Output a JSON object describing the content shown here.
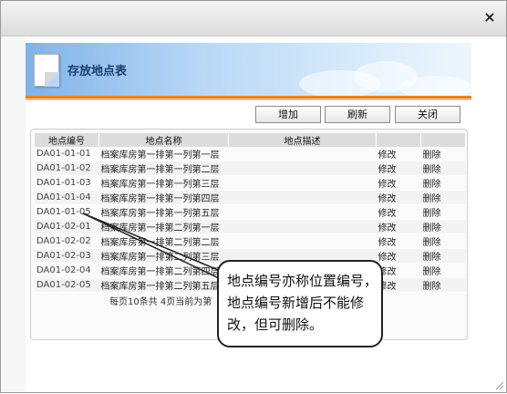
{
  "window": {
    "close_glyph": "×"
  },
  "panel": {
    "title": "存放地点表"
  },
  "toolbar": {
    "add": "增加",
    "refresh": "刷新",
    "close": "关闭"
  },
  "table": {
    "headers": [
      "地点编号",
      "地点名称",
      "地点描述",
      "",
      ""
    ],
    "rows": [
      {
        "code": "DA01-01-01",
        "name": "档案库房第一排第一列第一层",
        "desc": "",
        "edit": "修改",
        "del": "删除"
      },
      {
        "code": "DA01-01-02",
        "name": "档案库房第一排第一列第二层",
        "desc": "",
        "edit": "修改",
        "del": "删除"
      },
      {
        "code": "DA01-01-03",
        "name": "档案库房第一排第一列第三层",
        "desc": "",
        "edit": "修改",
        "del": "删除"
      },
      {
        "code": "DA01-01-04",
        "name": "档案库房第一排第一列第四层",
        "desc": "",
        "edit": "修改",
        "del": "删除"
      },
      {
        "code": "DA01-01-05",
        "name": "档案库房第一排第一列第五层",
        "desc": "",
        "edit": "修改",
        "del": "删除"
      },
      {
        "code": "DA01-02-01",
        "name": "档案库房第一排第二列第一层",
        "desc": "",
        "edit": "修改",
        "del": "删除"
      },
      {
        "code": "DA01-02-02",
        "name": "档案库房第一排第二列第二层",
        "desc": "",
        "edit": "修改",
        "del": "删除"
      },
      {
        "code": "DA01-02-03",
        "name": "档案库房第一排第二列第三层",
        "desc": "",
        "edit": "修改",
        "del": "删除"
      },
      {
        "code": "DA01-02-04",
        "name": "档案库房第一排第二列第四层",
        "desc": "",
        "edit": "修改",
        "del": "删除"
      },
      {
        "code": "DA01-02-05",
        "name": "档案库房第一排第二列第五层",
        "desc": "",
        "edit": "修改",
        "del": "删除"
      }
    ]
  },
  "pagination": {
    "text": "每页10条共  4页当前为第"
  },
  "callout": {
    "text": "地点编号亦称位置编号，地点编号新增后不能修改，但可删除。"
  },
  "colors": {
    "accent_orange": "#e2852b",
    "banner_blue": "#7fb4e8",
    "title_color": "#1a3e6e"
  }
}
